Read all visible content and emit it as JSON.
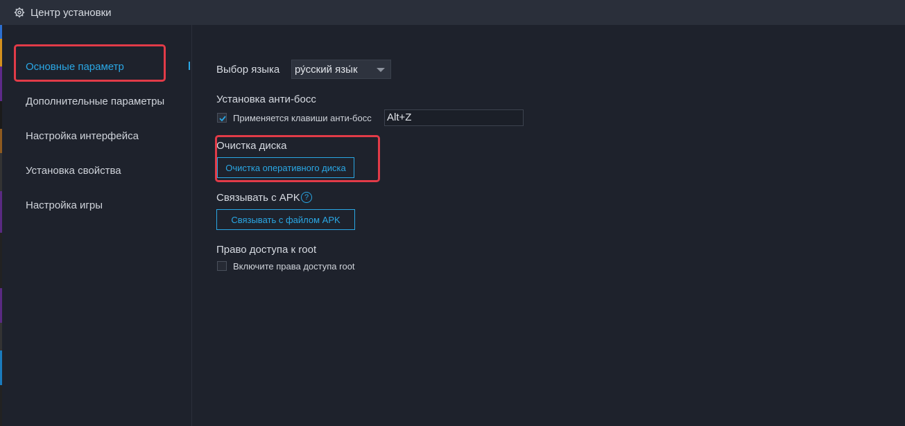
{
  "window": {
    "title": "Центр установки",
    "icon": "gear-icon"
  },
  "sidebar": {
    "items": [
      {
        "label": "Основные параметр",
        "active": true
      },
      {
        "label": "Дополнительные параметры"
      },
      {
        "label": "Настройка интерфейса"
      },
      {
        "label": "Установка свойства"
      },
      {
        "label": "Настройка игры"
      }
    ]
  },
  "language": {
    "label": "Выбор языка",
    "selected": "ру́сский язы́к"
  },
  "antiboss": {
    "heading": "Установка анти-босс",
    "checkbox_label": "Применяется клавиши анти-босс",
    "checked": true,
    "hotkey": "Alt+Z"
  },
  "disk": {
    "heading": "Очистка диска",
    "button": "Очистка оперативного диска"
  },
  "apk": {
    "heading": "Связывать с APK",
    "help_icon": "?",
    "button": "Связывать с файлом APK"
  },
  "root": {
    "heading": "Право доступа к root",
    "checkbox_label": "Включите права доступа root",
    "checked": false
  },
  "colors": {
    "accent": "#2aa8e6",
    "highlight": "#e23b48",
    "background": "#1e222c"
  }
}
